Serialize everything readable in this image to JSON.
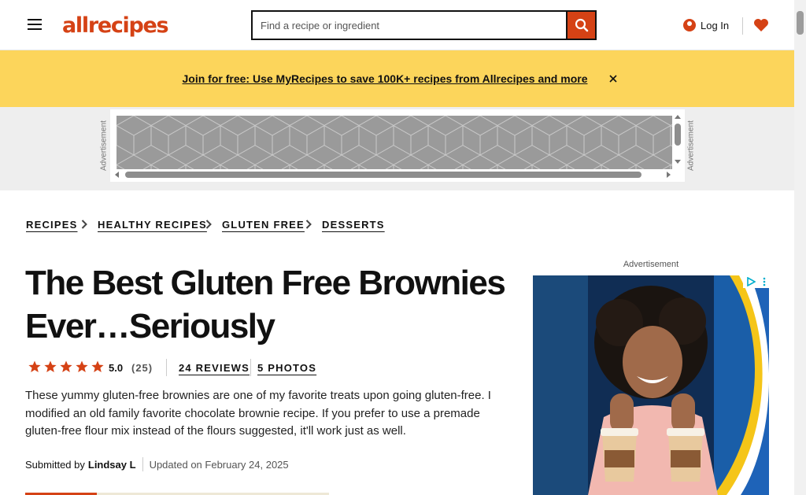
{
  "header": {
    "logo_text": "allrecipes",
    "search": {
      "placeholder": "Find a recipe or ingredient"
    },
    "login_label": "Log In"
  },
  "promo": {
    "link_text": "Join for free: Use MyRecipes to save 100K+ recipes from Allrecipes and more"
  },
  "ads": {
    "label": "Advertisement"
  },
  "breadcrumbs": [
    "RECIPES",
    "HEALTHY RECIPES",
    "GLUTEN FREE",
    "DESSERTS"
  ],
  "recipe": {
    "title": "The Best Gluten Free Brownies Ever…Seriously",
    "rating": {
      "stars": 5,
      "value": "5.0",
      "count": "(25)"
    },
    "reviews_label": "24 REVIEWS",
    "photos_label": "5 PHOTOS",
    "description": "These yummy gluten-free brownies are one of my favorite treats upon going gluten-free. I modified an old family favorite chocolate brownie recipe. If you prefer to use a premade gluten-free flour mix instead of the flours suggested, it'll work just as well.",
    "submitted_prefix": "Submitted by",
    "author": "Lindsay L",
    "updated": "Updated on February 24, 2025"
  },
  "colors": {
    "brand": "#d54215",
    "promo_bg": "#fcd55b",
    "star": "#d54215"
  }
}
